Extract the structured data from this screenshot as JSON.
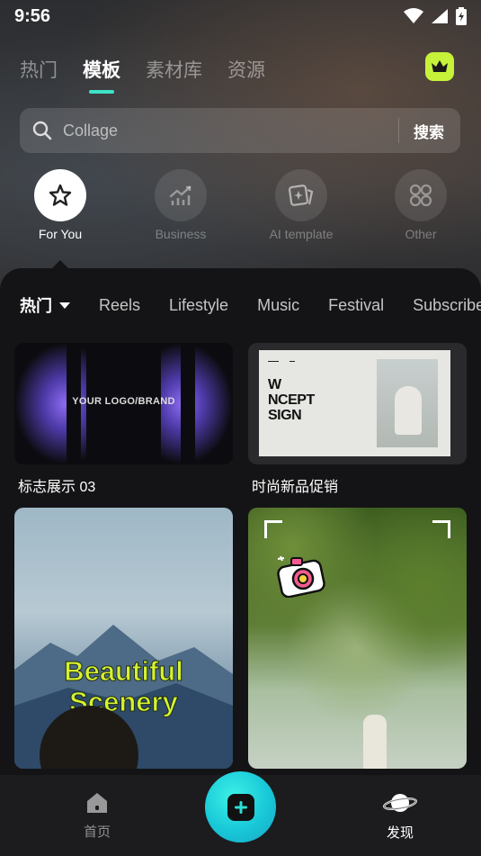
{
  "status_bar": {
    "time": "9:56",
    "icons": [
      "wifi-icon",
      "cellular-icon",
      "battery-charging-icon"
    ]
  },
  "top_tabs": [
    {
      "label": "热门",
      "active": false
    },
    {
      "label": "模板",
      "active": true
    },
    {
      "label": "素材库",
      "active": false
    },
    {
      "label": "资源",
      "active": false
    }
  ],
  "crown_button": {
    "icon": "crown-icon",
    "color": "#c6f23a"
  },
  "search": {
    "placeholder": "Collage",
    "button_label": "搜索"
  },
  "categories": [
    {
      "label": "For You",
      "icon": "star-icon",
      "active": true
    },
    {
      "label": "Business",
      "icon": "chart-icon",
      "active": false
    },
    {
      "label": "AI template",
      "icon": "ai-card-icon",
      "active": false
    },
    {
      "label": "Other",
      "icon": "grid-icon",
      "active": false
    }
  ],
  "filters": [
    {
      "label": "热门",
      "active": true
    },
    {
      "label": "Reels",
      "active": false
    },
    {
      "label": "Lifestyle",
      "active": false
    },
    {
      "label": "Music",
      "active": false
    },
    {
      "label": "Festival",
      "active": false
    },
    {
      "label": "Subscribe",
      "active": false
    }
  ],
  "templates": [
    {
      "title": "标志展示 03",
      "overlay_text": "YOUR LOGO/BRAND"
    },
    {
      "title": "时尚新品促销",
      "overlay_text": "W\nNCEPT\nSIGN"
    },
    {
      "title": "",
      "overlay_lines": [
        "Beautiful",
        "Scenery"
      ]
    },
    {
      "title": "",
      "overlay_text": ""
    }
  ],
  "bottom_nav": {
    "home": {
      "label": "首页",
      "icon": "home-icon"
    },
    "create": {
      "icon": "plus-icon"
    },
    "discover": {
      "label": "发现",
      "icon": "planet-icon",
      "active": true
    }
  },
  "colors": {
    "accent": "#3fe3c8",
    "crown": "#c6f23a",
    "scenery_text": "#d6f22f",
    "plus_button": "#18c8d8"
  }
}
